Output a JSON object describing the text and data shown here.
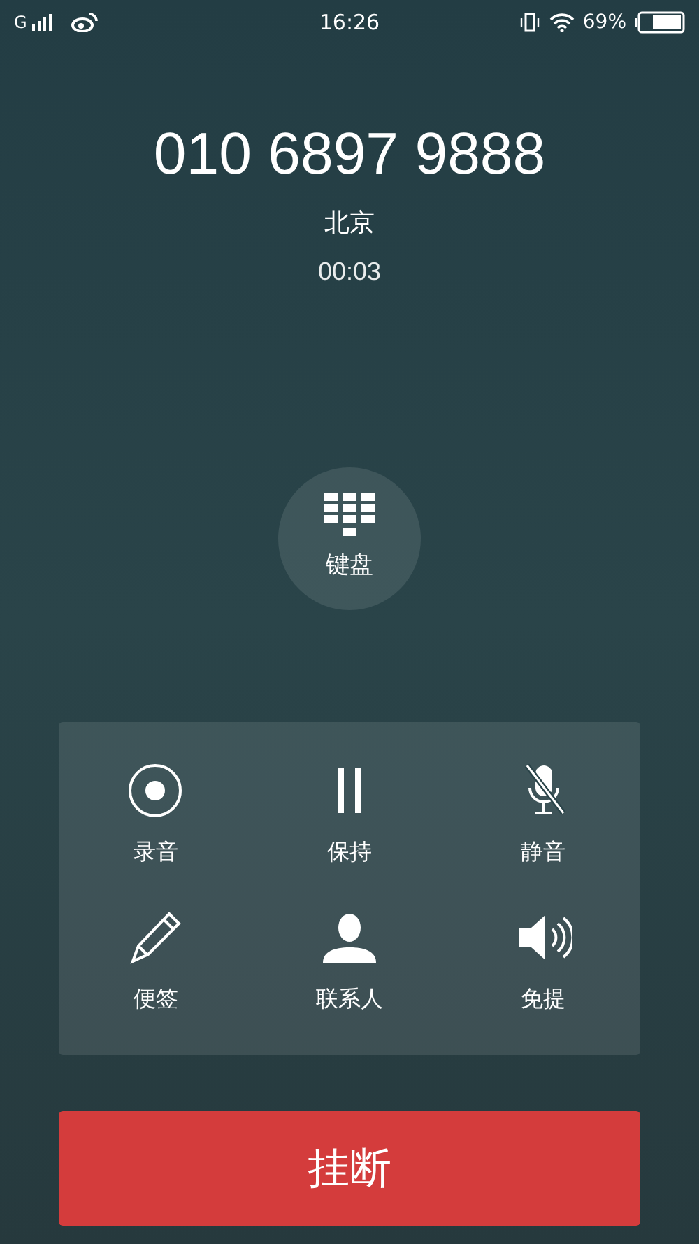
{
  "status_bar": {
    "network": "G",
    "time": "16:26",
    "battery": "69%"
  },
  "call": {
    "number": "010 6897 9888",
    "location": "北京",
    "duration": "00:03"
  },
  "keypad_button": {
    "label": "键盘"
  },
  "actions": [
    {
      "kind": "record",
      "label": "录音"
    },
    {
      "kind": "hold",
      "label": "保持"
    },
    {
      "kind": "mute",
      "label": "静音"
    },
    {
      "kind": "note",
      "label": "便签"
    },
    {
      "kind": "contacts",
      "label": "联系人"
    },
    {
      "kind": "speaker",
      "label": "免提"
    }
  ],
  "hangup_button": {
    "label": "挂断"
  }
}
